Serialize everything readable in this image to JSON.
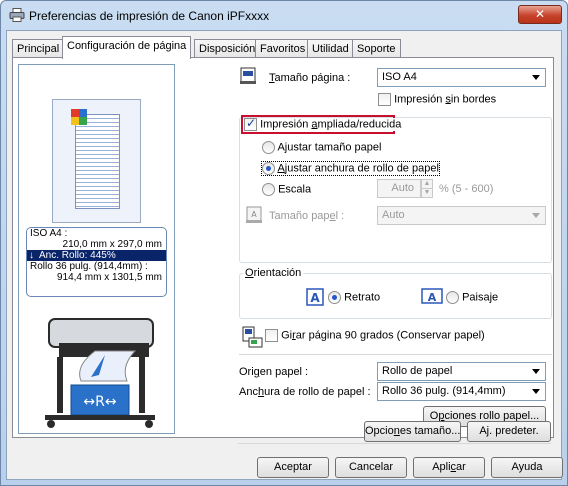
{
  "window": {
    "title": "Preferencias de impresión de Canon iPFxxxx",
    "close": "✕"
  },
  "tabs": [
    "Principal",
    "Configuración de página",
    "Disposición",
    "Favoritos",
    "Utilidad",
    "Soporte"
  ],
  "preview": {
    "info_line1": "ISO A4 :",
    "info_line2": "210,0 mm x 297,0 mm",
    "info_highlight": "Anc. Rollo: 445%",
    "info_line4": "Rollo 36 pulg. (914,4mm) :",
    "info_line5": "914,4 mm x 1301,5 mm",
    "arrow": "↓"
  },
  "page_size": {
    "label_pre": "",
    "label_u": "T",
    "label_post": "amaño página :",
    "value": "ISO A4"
  },
  "borderless": {
    "pre": "Impresión ",
    "u": "s",
    "post": "in bordes",
    "checked": false
  },
  "scaled": {
    "pre": "Impresión ",
    "u": "a",
    "post": "mpliada/reducida",
    "checked": true
  },
  "fit_paper": {
    "pre": "A",
    "u": "j",
    "post": "ustar tamaño papel"
  },
  "fit_roll": {
    "pre": "",
    "u": "A",
    "post": "justar anchura de rollo de papel"
  },
  "scale": {
    "label": "Escala",
    "value": "Auto",
    "range": "% (5 - 600)"
  },
  "paper_size": {
    "pre": "Tamaño pap",
    "u": "e",
    "post": "l :",
    "value": "Auto"
  },
  "orientation": {
    "title_u": "O",
    "title_post": "rientación",
    "portrait": "Retrato",
    "landscape": "Paisaje"
  },
  "rotate": {
    "pre": "Gi",
    "u": "r",
    "post": "ar página 90 grados (Conservar papel)",
    "checked": false
  },
  "paper_source": {
    "pre": "Ori",
    "u": "g",
    "post": "en papel :",
    "value": "Rollo de papel"
  },
  "roll_width": {
    "pre": "Anc",
    "u": "h",
    "post": "ura de rollo de papel :",
    "value": "Rollo 36 pulg. (914,4mm)"
  },
  "buttons": {
    "roll_options_pre": "O",
    "roll_options_u": "p",
    "roll_options_post": "ciones rollo papel...",
    "size_options_pre": "Opcio",
    "size_options_u": "n",
    "size_options_post": "es tamaño...",
    "defaults_pre": "A",
    "defaults_u": "j",
    "defaults_post": ". predeter.",
    "ok": "Aceptar",
    "cancel": "Cancelar",
    "apply_pre": "Apli",
    "apply_u": "c",
    "apply_post": "ar",
    "help": "Ayuda"
  }
}
